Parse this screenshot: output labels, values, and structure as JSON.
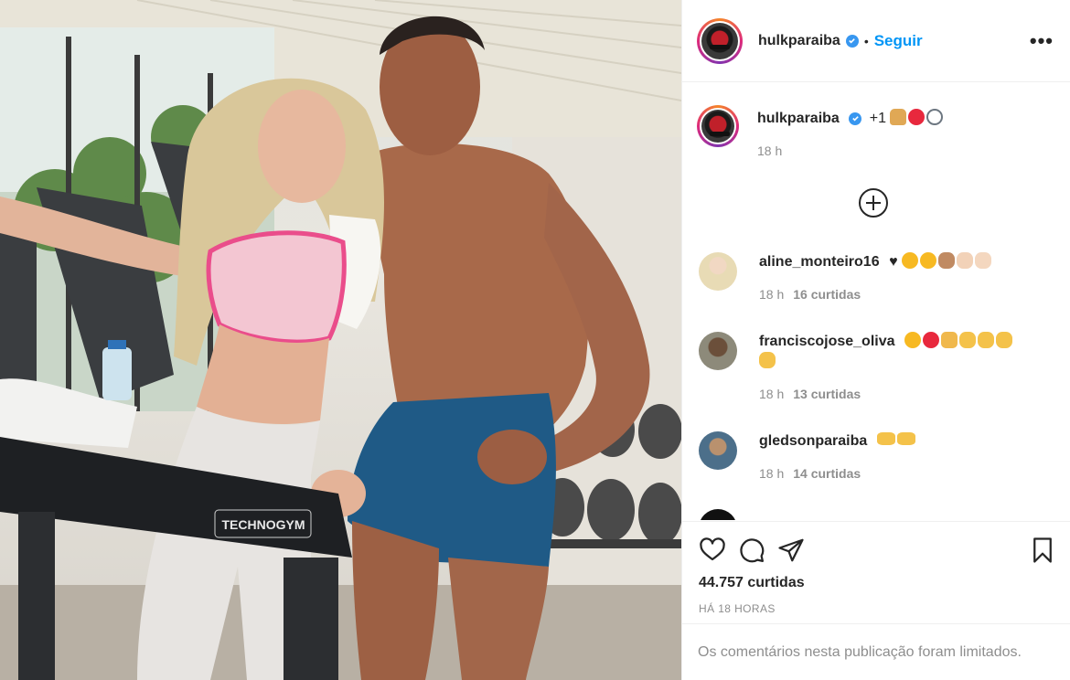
{
  "post": {
    "author": "hulkparaiba",
    "follow_label": "Seguir",
    "more_label": "•••",
    "caption": {
      "user": "hulkparaiba",
      "text": "+1",
      "emojis": [
        "folded-hands",
        "red-heart",
        "ring"
      ],
      "time": "18 h"
    },
    "likes": "44.757 curtidas",
    "timestamp": "HÁ 18 HORAS",
    "comments_limited": "Os comentários nesta publicação foram limitados.",
    "photo_brand": "TECHNOGYM",
    "comments": [
      {
        "user": "aline_monteiro16",
        "text": "♥",
        "emojis": [
          "heart-eyes",
          "heart-eyes",
          "flexed-biceps",
          "fist-bump",
          "clapping-hands"
        ],
        "time": "18 h",
        "likes": "16 curtidas"
      },
      {
        "user": "franciscojose_oliva",
        "text": "",
        "emojis": [
          "winking-kiss",
          "red-heart",
          "folded-hands",
          "clapping-hands",
          "clapping-hands",
          "clapping-hands",
          "clapping-hands"
        ],
        "time": "18 h",
        "likes": "13 curtidas"
      },
      {
        "user": "gledsonparaiba",
        "text": "",
        "emojis": [
          "fist-bump-left",
          "fist-bump-right"
        ],
        "time": "18 h",
        "likes": "14 curtidas"
      }
    ]
  },
  "colors": {
    "link": "#0095f6",
    "verified": "#3897f0",
    "text": "#262626",
    "muted": "#8e8e8e",
    "border": "#efefef"
  }
}
